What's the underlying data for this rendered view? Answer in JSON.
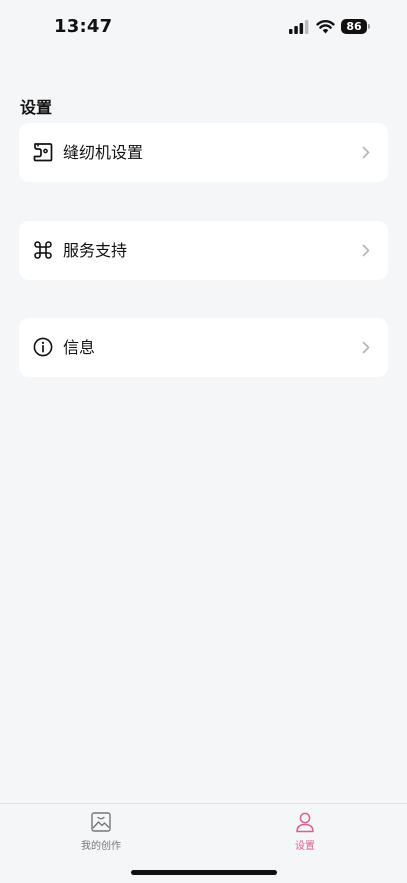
{
  "status_bar": {
    "time": "13:47",
    "battery_level": "86"
  },
  "section": {
    "title": "设置"
  },
  "menu": [
    {
      "label": "缝纫机设置",
      "icon": "sewing-machine-icon"
    },
    {
      "label": "服务支持",
      "icon": "command-clover-icon"
    },
    {
      "label": "信息",
      "icon": "info-circle-icon"
    }
  ],
  "tab_bar": {
    "tabs": [
      {
        "label": "我的创作",
        "icon": "picture-frame-icon",
        "active": false
      },
      {
        "label": "设置",
        "icon": "person-icon",
        "active": true
      }
    ]
  },
  "colors": {
    "background": "#f5f6f8",
    "card": "#ffffff",
    "accent": "#e25d8a",
    "inactive_tab": "#777777"
  }
}
